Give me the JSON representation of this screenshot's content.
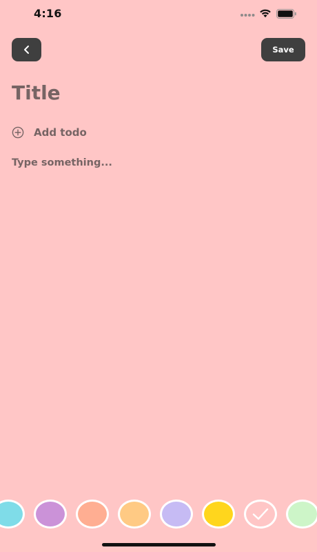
{
  "status_bar": {
    "time": "4:16",
    "signal_icon": "signal-dots-icon",
    "wifi_icon": "wifi-icon",
    "battery_icon": "battery-icon"
  },
  "header": {
    "back_icon": "chevron-left-icon",
    "save_label": "Save"
  },
  "note": {
    "title_placeholder": "Title",
    "title_value": "",
    "add_todo_icon": "plus-circle-icon",
    "add_todo_label": "Add todo",
    "body_placeholder": "Type something...",
    "body_value": ""
  },
  "colors": {
    "background": "#FFC6C6",
    "button_bg": "#3F3F3F",
    "text_muted": "#766464",
    "swatches": [
      {
        "name": "cyan",
        "color": "#7FDCE8",
        "selected": false
      },
      {
        "name": "purple",
        "color": "#CB92D8",
        "selected": false
      },
      {
        "name": "salmon",
        "color": "#FFAE92",
        "selected": false
      },
      {
        "name": "peach",
        "color": "#FFCA84",
        "selected": false
      },
      {
        "name": "lavender",
        "color": "#C6BBF4",
        "selected": false
      },
      {
        "name": "yellow",
        "color": "#FFD61D",
        "selected": false
      },
      {
        "name": "pink",
        "color": "#FFC6C6",
        "selected": true
      },
      {
        "name": "mint",
        "color": "#CDF5C8",
        "selected": false
      }
    ]
  }
}
